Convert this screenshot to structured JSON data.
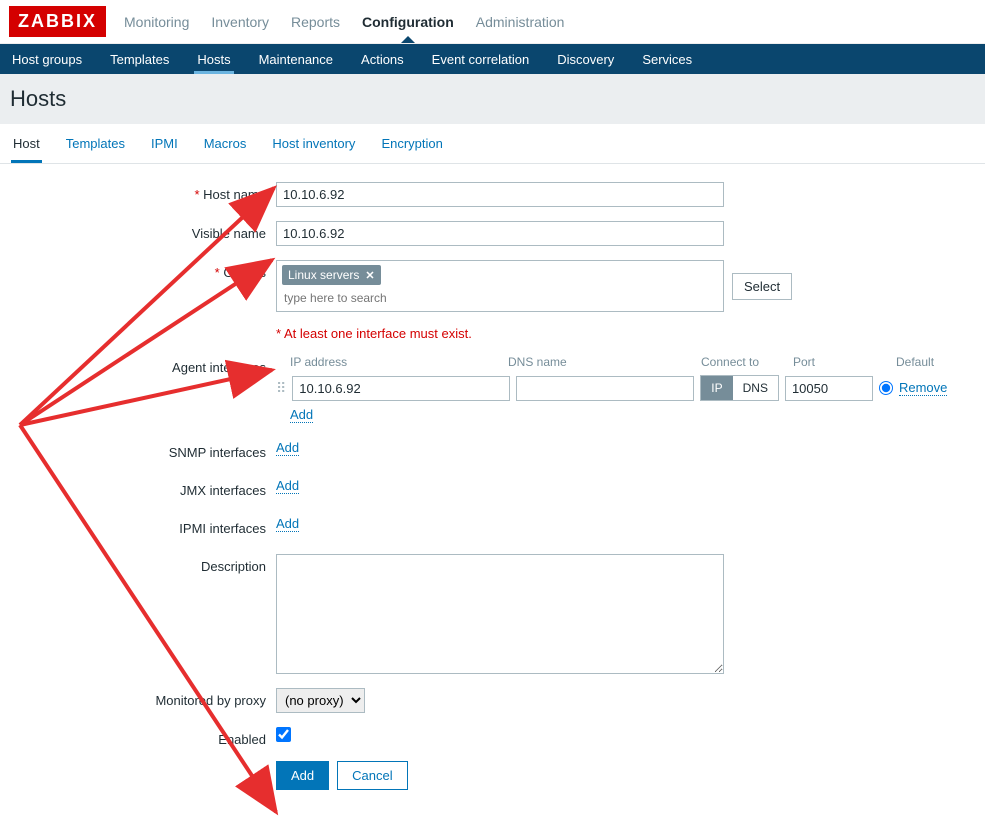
{
  "logo": "ZABBIX",
  "topnav": {
    "monitoring": "Monitoring",
    "inventory": "Inventory",
    "reports": "Reports",
    "configuration": "Configuration",
    "administration": "Administration"
  },
  "subnav": {
    "host_groups": "Host groups",
    "templates": "Templates",
    "hosts": "Hosts",
    "maintenance": "Maintenance",
    "actions": "Actions",
    "event_correlation": "Event correlation",
    "discovery": "Discovery",
    "services": "Services"
  },
  "page_title": "Hosts",
  "tabs": {
    "host": "Host",
    "templates": "Templates",
    "ipmi": "IPMI",
    "macros": "Macros",
    "host_inventory": "Host inventory",
    "encryption": "Encryption"
  },
  "labels": {
    "host_name": "Host name",
    "visible_name": "Visible name",
    "groups": "Groups",
    "at_least_one": "At least one interface must exist.",
    "agent_interfaces": "Agent interfaces",
    "snmp_interfaces": "SNMP interfaces",
    "jmx_interfaces": "JMX interfaces",
    "ipmi_interfaces": "IPMI interfaces",
    "description": "Description",
    "monitored_by_proxy": "Monitored by proxy",
    "enabled": "Enabled"
  },
  "iface_head": {
    "ip": "IP address",
    "dns": "DNS name",
    "connect_to": "Connect to",
    "port": "Port",
    "default": "Default"
  },
  "values": {
    "host_name": "10.10.6.92",
    "visible_name": "10.10.6.92",
    "group_tag": "Linux servers",
    "group_placeholder": "type here to search",
    "agent_ip": "10.10.6.92",
    "agent_dns": "",
    "agent_port": "10050",
    "proxy": "(no proxy)",
    "enabled": true
  },
  "buttons": {
    "select": "Select",
    "add_link": "Add",
    "remove": "Remove",
    "add": "Add",
    "cancel": "Cancel"
  },
  "toggle": {
    "ip": "IP",
    "dns": "DNS"
  }
}
